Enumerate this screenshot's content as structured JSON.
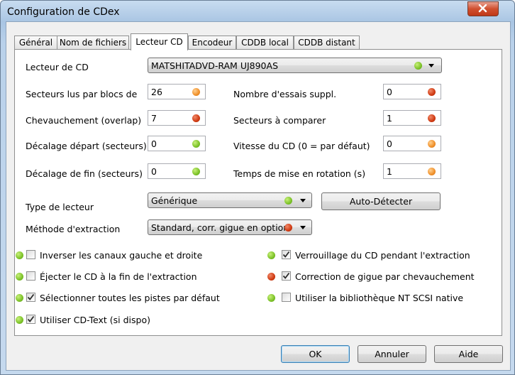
{
  "window": {
    "title": "Configuration de CDex"
  },
  "tabs": [
    {
      "label": "Général"
    },
    {
      "label": "Nom de fichiers"
    },
    {
      "label": "Lecteur CD"
    },
    {
      "label": "Encodeur"
    },
    {
      "label": "CDDB local"
    },
    {
      "label": "CDDB distant"
    }
  ],
  "drive": {
    "label": "Lecteur de CD",
    "value": "MATSHITADVD-RAM UJ890AS",
    "status": "green"
  },
  "left_fields": [
    {
      "label": "Secteurs lus par blocs de",
      "value": "26",
      "status": "orange"
    },
    {
      "label": "Chevauchement (overlap)",
      "value": "7",
      "status": "red"
    },
    {
      "label": "Décalage départ (secteurs)",
      "value": "0",
      "status": "green"
    },
    {
      "label": "Décalage de fin (secteurs)",
      "value": "0",
      "status": "green"
    }
  ],
  "right_fields": [
    {
      "label": "Nombre d'essais suppl.",
      "value": "0",
      "status": "red"
    },
    {
      "label": "Secteurs à comparer",
      "value": "1",
      "status": "red"
    },
    {
      "label": "Vitesse du CD (0 = par défaut)",
      "value": "0",
      "status": "orange"
    },
    {
      "label": "Temps de mise en rotation (s)",
      "value": "1",
      "status": "orange"
    }
  ],
  "drive_type": {
    "label": "Type de lecteur",
    "value": "Générique",
    "status": "green",
    "autodetect": "Auto-Détecter"
  },
  "extraction": {
    "label": "Méthode d'extraction",
    "value": "Standard, corr. gigue en option",
    "status": "red"
  },
  "checks_left": [
    {
      "label": "Inverser les canaux gauche et droite",
      "checked": false,
      "status": "green"
    },
    {
      "label": "Éjecter le CD à la fin de l'extraction",
      "checked": false,
      "status": "green"
    },
    {
      "label": "Sélectionner toutes les pistes par défaut",
      "checked": true,
      "status": "green"
    },
    {
      "label": "Utiliser CD-Text (si dispo)",
      "checked": true,
      "status": "green"
    }
  ],
  "checks_right": [
    {
      "label": "Verrouillage du CD pendant l'extraction",
      "checked": true,
      "status": "green"
    },
    {
      "label": "Correction de gigue par chevauchement",
      "checked": true,
      "status": "red"
    },
    {
      "label": "Utiliser la bibliothèque NT SCSI native",
      "checked": false,
      "status": "green"
    }
  ],
  "buttons": {
    "ok": "OK",
    "cancel": "Annuler",
    "help": "Aide"
  },
  "colors": {
    "green": "#7cc228",
    "orange": "#f0902a",
    "red": "#d03a12"
  }
}
